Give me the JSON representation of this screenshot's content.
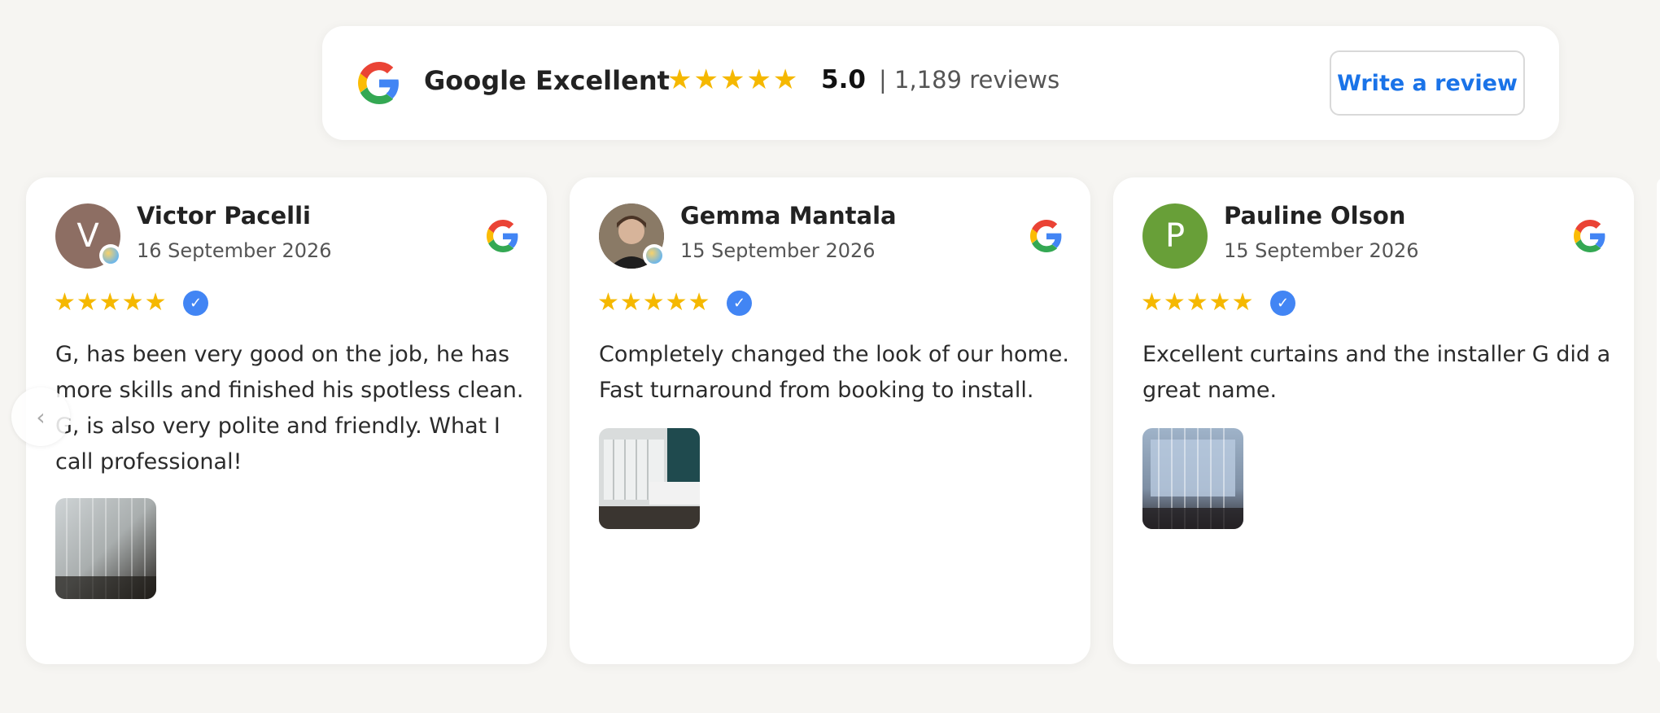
{
  "summary": {
    "brand": "Google",
    "rating_word": "Excellent",
    "stars": "★★★★★",
    "score": "5.0",
    "review_count": "| 1,189 reviews",
    "write_review_label": "Write a review",
    "colors": {
      "star": "#f5b800",
      "button_text": "#1a73e8"
    }
  },
  "carousel": {
    "prev_label": "‹",
    "reviews": [
      {
        "initial": "V",
        "avatar_color": "#8d6e63",
        "name": "Victor Pacelli",
        "date": "16 September 2026",
        "stars": "★★★★★",
        "verified": "✓",
        "text": "G, has been very good on the job, he has more skills and finished his spotless clean. G, is also very polite and friendly. What I call professional!"
      },
      {
        "initial": "",
        "avatar_color": "#5a4a40",
        "name": "Gemma Mantala",
        "date": "15 September 2026",
        "stars": "★★★★★",
        "verified": "✓",
        "text": "Completely changed the look of our home. Fast turnaround from booking to install."
      },
      {
        "initial": "P",
        "avatar_color": "#689f38",
        "name": "Pauline Olson",
        "date": "15 September 2026",
        "stars": "★★★★★",
        "verified": "✓",
        "text": "Excellent curtains and the installer G did a great name."
      }
    ]
  }
}
